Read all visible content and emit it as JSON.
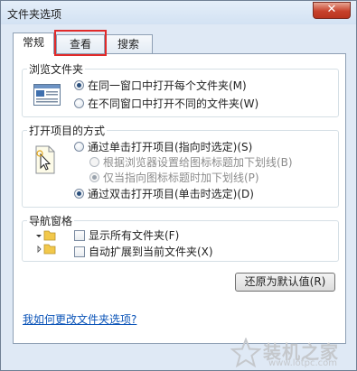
{
  "window": {
    "title": "文件夹选项",
    "close_label": "✕"
  },
  "tabs": [
    {
      "label": "常规",
      "active": true
    },
    {
      "label": "查看",
      "active": false
    },
    {
      "label": "搜索",
      "active": false
    }
  ],
  "browse": {
    "legend": "浏览文件夹",
    "options": [
      {
        "label": "在同一窗口中打开每个文件夹(M)",
        "checked": true
      },
      {
        "label": "在不同窗口中打开不同的文件夹(W)",
        "checked": false
      }
    ]
  },
  "open_items": {
    "legend": "打开项目的方式",
    "options": [
      {
        "label": "通过单击打开项目(指向时选定)(S)",
        "checked": false,
        "disabled": false
      },
      {
        "label": "根据浏览器设置给图标标题加下划线(B)",
        "checked": false,
        "disabled": true
      },
      {
        "label": "仅当指向图标标题时加下划线(P)",
        "checked": true,
        "disabled": true
      },
      {
        "label": "通过双击打开项目(单击时选定)(D)",
        "checked": true,
        "disabled": false
      }
    ]
  },
  "nav_pane": {
    "legend": "导航窗格",
    "options": [
      {
        "label": "显示所有文件夹(F)",
        "checked": false
      },
      {
        "label": "自动扩展到当前文件夹(X)",
        "checked": false
      }
    ]
  },
  "restore_button": "还原为默认值(R)",
  "help_link": "我如何更改文件夹选项?",
  "watermark": {
    "text": "装机之家",
    "url": "www.lotpc.com"
  },
  "colors": {
    "highlight_box": "#e12a2a",
    "link": "#0b54b8"
  }
}
